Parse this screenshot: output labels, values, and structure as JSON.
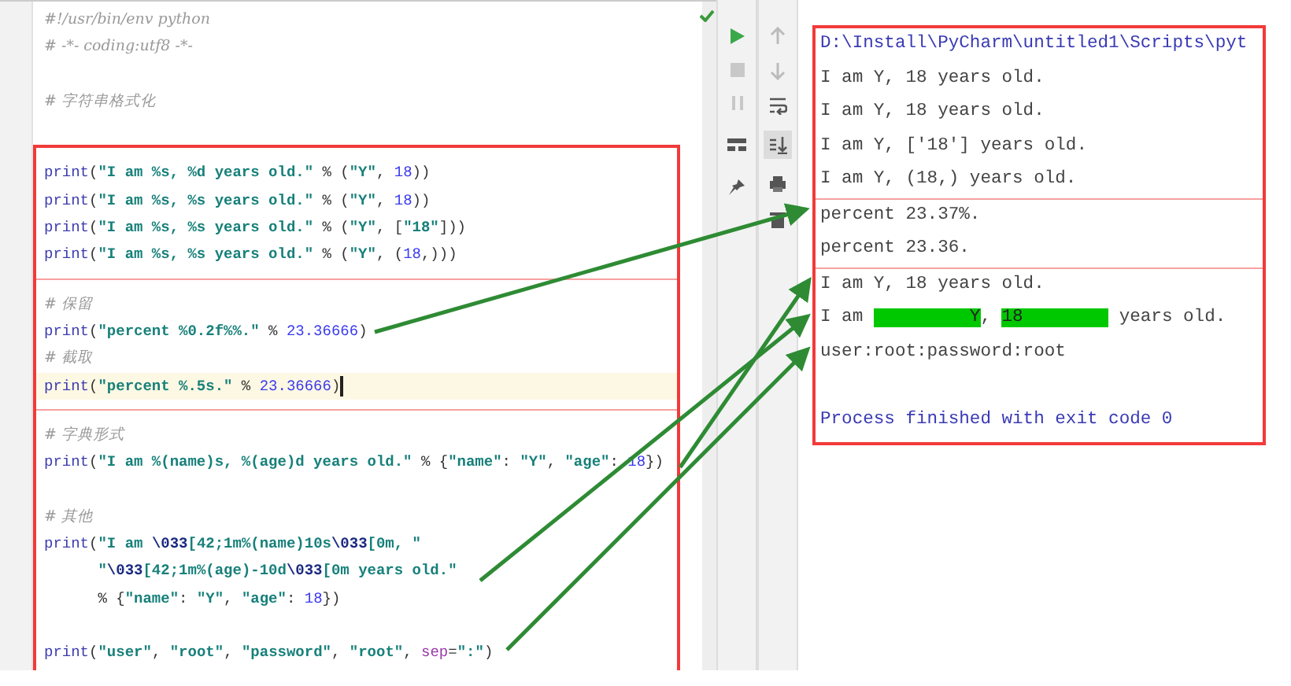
{
  "editor": {
    "header_lines": [
      {
        "kind": "comment",
        "text": "#!/usr/bin/env python"
      },
      {
        "kind": "comment",
        "text": "# -*- coding:utf8 -*-"
      },
      {
        "kind": "blank"
      },
      {
        "kind": "comment",
        "text": "# 字符串格式化"
      },
      {
        "kind": "blank"
      }
    ],
    "boxed_sections": [
      [
        {
          "kind": "code",
          "current": false,
          "tokens": [
            {
              "kind": "kw",
              "text": "print"
            },
            {
              "kind": "punc",
              "text": "("
            },
            {
              "kind": "str",
              "text": "\"I am %s, %d years old.\""
            },
            {
              "kind": "punc",
              "text": " % ("
            },
            {
              "kind": "str",
              "text": "\"Y\""
            },
            {
              "kind": "punc",
              "text": ", "
            },
            {
              "kind": "num",
              "text": "18"
            },
            {
              "kind": "punc",
              "text": "))"
            }
          ]
        },
        {
          "kind": "code",
          "current": false,
          "tokens": [
            {
              "kind": "kw",
              "text": "print"
            },
            {
              "kind": "punc",
              "text": "("
            },
            {
              "kind": "str",
              "text": "\"I am %s, %s years old.\""
            },
            {
              "kind": "punc",
              "text": " % ("
            },
            {
              "kind": "str",
              "text": "\"Y\""
            },
            {
              "kind": "punc",
              "text": ", "
            },
            {
              "kind": "num",
              "text": "18"
            },
            {
              "kind": "punc",
              "text": "))"
            }
          ]
        },
        {
          "kind": "code",
          "current": false,
          "tokens": [
            {
              "kind": "kw",
              "text": "print"
            },
            {
              "kind": "punc",
              "text": "("
            },
            {
              "kind": "str",
              "text": "\"I am %s, %s years old.\""
            },
            {
              "kind": "punc",
              "text": " % ("
            },
            {
              "kind": "str",
              "text": "\"Y\""
            },
            {
              "kind": "punc",
              "text": ", ["
            },
            {
              "kind": "str",
              "text": "\"18\""
            },
            {
              "kind": "punc",
              "text": "]))"
            }
          ]
        },
        {
          "kind": "code",
          "current": false,
          "tokens": [
            {
              "kind": "kw",
              "text": "print"
            },
            {
              "kind": "punc",
              "text": "("
            },
            {
              "kind": "str",
              "text": "\"I am %s, %s years old.\""
            },
            {
              "kind": "punc",
              "text": " % ("
            },
            {
              "kind": "str",
              "text": "\"Y\""
            },
            {
              "kind": "punc",
              "text": ", ("
            },
            {
              "kind": "num",
              "text": "18"
            },
            {
              "kind": "punc",
              "text": ",)))"
            }
          ]
        }
      ],
      [
        {
          "kind": "comment",
          "text": "# 保留"
        },
        {
          "kind": "code",
          "current": false,
          "tokens": [
            {
              "kind": "kw",
              "text": "print"
            },
            {
              "kind": "punc",
              "text": "("
            },
            {
              "kind": "str",
              "text": "\"percent %0.2f%%.\""
            },
            {
              "kind": "punc",
              "text": " % "
            },
            {
              "kind": "num",
              "text": "23.36666"
            },
            {
              "kind": "punc",
              "text": ")"
            }
          ]
        },
        {
          "kind": "comment",
          "text": "# 截取"
        },
        {
          "kind": "code",
          "current": true,
          "tokens": [
            {
              "kind": "kw",
              "text": "print"
            },
            {
              "kind": "punc",
              "text": "("
            },
            {
              "kind": "str",
              "text": "\"percent %.5s.\""
            },
            {
              "kind": "punc",
              "text": " % "
            },
            {
              "kind": "num",
              "text": "23.36666"
            },
            {
              "kind": "punc",
              "text": ")"
            }
          ]
        }
      ],
      [
        {
          "kind": "comment",
          "text": "# 字典形式"
        },
        {
          "kind": "code",
          "current": false,
          "tokens": [
            {
              "kind": "kw",
              "text": "print"
            },
            {
              "kind": "punc",
              "text": "("
            },
            {
              "kind": "str",
              "text": "\"I am %(name)s, %(age)d years old.\""
            },
            {
              "kind": "punc",
              "text": " % {"
            },
            {
              "kind": "str",
              "text": "\"name\""
            },
            {
              "kind": "punc",
              "text": ": "
            },
            {
              "kind": "str",
              "text": "\"Y\""
            },
            {
              "kind": "punc",
              "text": ", "
            },
            {
              "kind": "str",
              "text": "\"age\""
            },
            {
              "kind": "punc",
              "text": ": "
            },
            {
              "kind": "num",
              "text": "18"
            },
            {
              "kind": "punc",
              "text": "})"
            }
          ]
        },
        {
          "kind": "blank"
        },
        {
          "kind": "comment",
          "text": "# 其他"
        },
        {
          "kind": "code",
          "current": false,
          "tokens": [
            {
              "kind": "kw",
              "text": "print"
            },
            {
              "kind": "punc",
              "text": "("
            },
            {
              "kind": "str",
              "text": "\"I am "
            },
            {
              "kind": "esc",
              "text": "\\033"
            },
            {
              "kind": "str",
              "text": "[42;1m%(name)10s"
            },
            {
              "kind": "esc",
              "text": "\\033"
            },
            {
              "kind": "str",
              "text": "[0m, \""
            }
          ]
        },
        {
          "kind": "code",
          "current": false,
          "tokens": [
            {
              "kind": "str",
              "text": "      \""
            },
            {
              "kind": "esc",
              "text": "\\033"
            },
            {
              "kind": "str",
              "text": "[42;1m%(age)-10d"
            },
            {
              "kind": "esc",
              "text": "\\033"
            },
            {
              "kind": "str",
              "text": "[0m years old.\""
            }
          ]
        },
        {
          "kind": "code",
          "current": false,
          "tokens": [
            {
              "kind": "punc",
              "text": "      % {"
            },
            {
              "kind": "str",
              "text": "\"name\""
            },
            {
              "kind": "punc",
              "text": ": "
            },
            {
              "kind": "str",
              "text": "\"Y\""
            },
            {
              "kind": "punc",
              "text": ", "
            },
            {
              "kind": "str",
              "text": "\"age\""
            },
            {
              "kind": "punc",
              "text": ": "
            },
            {
              "kind": "num",
              "text": "18"
            },
            {
              "kind": "punc",
              "text": "})"
            }
          ]
        },
        {
          "kind": "blank"
        },
        {
          "kind": "code",
          "current": false,
          "tokens": [
            {
              "kind": "kw",
              "text": "print"
            },
            {
              "kind": "punc",
              "text": "("
            },
            {
              "kind": "str",
              "text": "\"user\""
            },
            {
              "kind": "punc",
              "text": ", "
            },
            {
              "kind": "str",
              "text": "\"root\""
            },
            {
              "kind": "punc",
              "text": ", "
            },
            {
              "kind": "str",
              "text": "\"password\""
            },
            {
              "kind": "punc",
              "text": ", "
            },
            {
              "kind": "str",
              "text": "\"root\""
            },
            {
              "kind": "punc",
              "text": ", "
            },
            {
              "kind": "param",
              "text": "sep"
            },
            {
              "kind": "punc",
              "text": "="
            },
            {
              "kind": "str",
              "text": "\":\""
            },
            {
              "kind": "punc",
              "text": ")"
            }
          ]
        }
      ]
    ]
  },
  "console": {
    "sections": [
      [
        {
          "kind": "command",
          "text": "D:\\Install\\PyCharm\\untitled1\\Scripts\\pyt"
        },
        {
          "kind": "output",
          "text": "I am Y, 18 years old."
        },
        {
          "kind": "output",
          "text": "I am Y, 18 years old."
        },
        {
          "kind": "output",
          "text": "I am Y, ['18'] years old."
        },
        {
          "kind": "output",
          "text": "I am Y, (18,) years old."
        }
      ],
      [
        {
          "kind": "output",
          "text": "percent 23.37%."
        },
        {
          "kind": "output",
          "text": "percent 23.36."
        }
      ],
      [
        {
          "kind": "output",
          "text": "I am Y, 18 years old."
        },
        {
          "kind": "styled",
          "segments": [
            {
              "text": "I am ",
              "highlight": false
            },
            {
              "text": "         Y",
              "highlight": true
            },
            {
              "text": ", ",
              "highlight": false
            },
            {
              "text": "18        ",
              "highlight": true
            },
            {
              "text": " years old.",
              "highlight": false
            }
          ]
        },
        {
          "kind": "output",
          "text": "user:root:password:root"
        },
        {
          "kind": "blank"
        },
        {
          "kind": "exit",
          "text": "Process finished with exit code 0"
        }
      ]
    ]
  }
}
